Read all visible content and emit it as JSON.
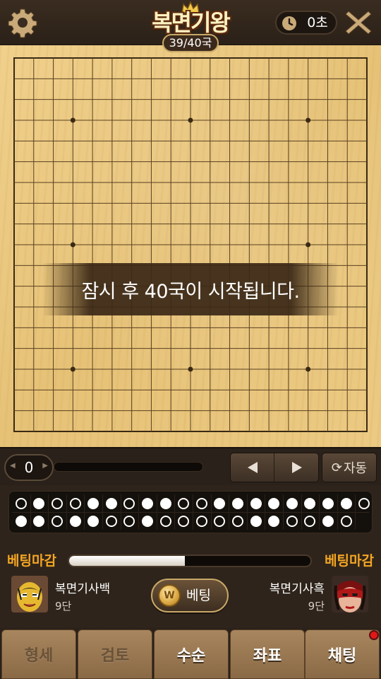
{
  "header": {
    "settings_icon": "gear-icon",
    "title": "복면기왕",
    "round": "39/40국",
    "timer_icon": "clock-icon",
    "timer": "0초",
    "close_icon": "close-icon"
  },
  "board": {
    "size": 19,
    "notice": "잠시 후 40국이 시작됩니다."
  },
  "controls": {
    "move_number": "0",
    "prev_icon": "triangle-left-icon",
    "next_icon": "triangle-right-icon",
    "auto_label": "자동",
    "auto_icon": "refresh-icon"
  },
  "history": {
    "row1": [
      "empty",
      "white",
      "empty",
      "empty",
      "white",
      "white",
      "empty",
      "white",
      "white",
      "empty",
      "empty",
      "white",
      "white",
      "white",
      "white",
      "white",
      "white",
      "white",
      "white",
      "empty"
    ],
    "row2": [
      "white",
      "white",
      "empty",
      "white",
      "white",
      "empty",
      "empty",
      "white",
      "empty",
      "empty",
      "empty",
      "empty",
      "empty",
      "white",
      "white",
      "empty",
      "empty",
      "white",
      "empty"
    ]
  },
  "betting": {
    "left_label": "베팅마감",
    "right_label": "베팅마감",
    "progress_percent": 48,
    "button_label": "베팅",
    "coin_symbol": "W"
  },
  "players": {
    "white": {
      "name": "복면기사백",
      "rank": "9단"
    },
    "black": {
      "name": "복면기사흑",
      "rank": "9단"
    }
  },
  "tabs": [
    {
      "label": "형세"
    },
    {
      "label": "검토"
    },
    {
      "label": "수순"
    },
    {
      "label": "좌표"
    },
    {
      "label": "채팅"
    }
  ],
  "colors": {
    "accent": "#f5a623",
    "board": "#e9c67e",
    "notification": "#e01818"
  }
}
